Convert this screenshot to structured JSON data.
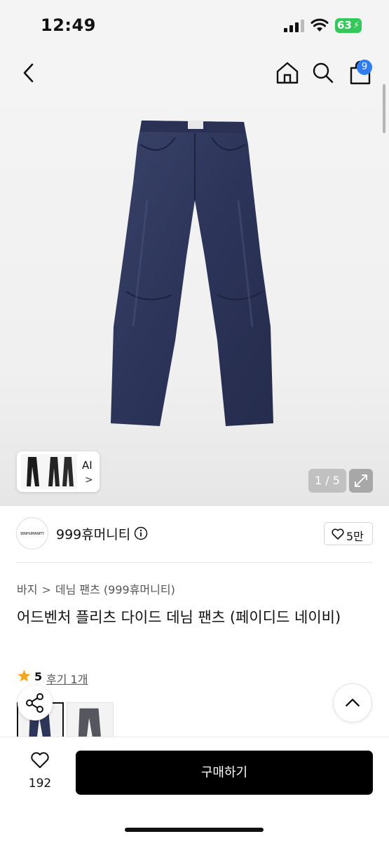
{
  "status_bar": {
    "time": "12:49",
    "battery": "63"
  },
  "header": {
    "cart_count": "9"
  },
  "gallery": {
    "ai_label": "AI",
    "counter": "1 / 5"
  },
  "store": {
    "logo_text": "999HUMANITY",
    "name": "999휴머니티",
    "likes": "5만"
  },
  "breadcrumb": {
    "category": "바지",
    "separator": ">",
    "subcategory": "데님 팬츠 (999휴머니티)"
  },
  "product": {
    "title": "어드벤처 플리츠 다이드 데님 팬츠 (페이디드 네이비)"
  },
  "rating": {
    "score": "5",
    "reviews": "후기 1개"
  },
  "bottom_bar": {
    "wish_count": "192",
    "buy_label": "구매하기"
  },
  "colors": {
    "accent_blue": "#2f7cf6",
    "battery_green": "#34c759",
    "star": "#f5a623",
    "denim": "#2e3658"
  }
}
